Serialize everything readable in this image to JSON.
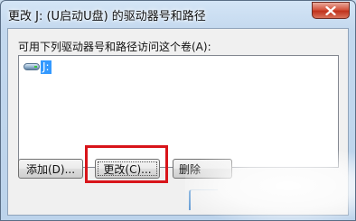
{
  "window": {
    "title": "更改 J: (U启动U盘) 的驱动器号和路径",
    "close_icon": "close-icon"
  },
  "main": {
    "list_label": "可用下列驱动器号和路径访问这个卷(A):",
    "volumes": [
      {
        "label": "J:",
        "icon": "drive-icon",
        "selected": true
      }
    ]
  },
  "buttons": {
    "add": "添加(D)...",
    "change": "更改(C)...",
    "delete": "删除"
  },
  "colors": {
    "highlight_box": "#d8141a",
    "selection": "#3399ff"
  }
}
